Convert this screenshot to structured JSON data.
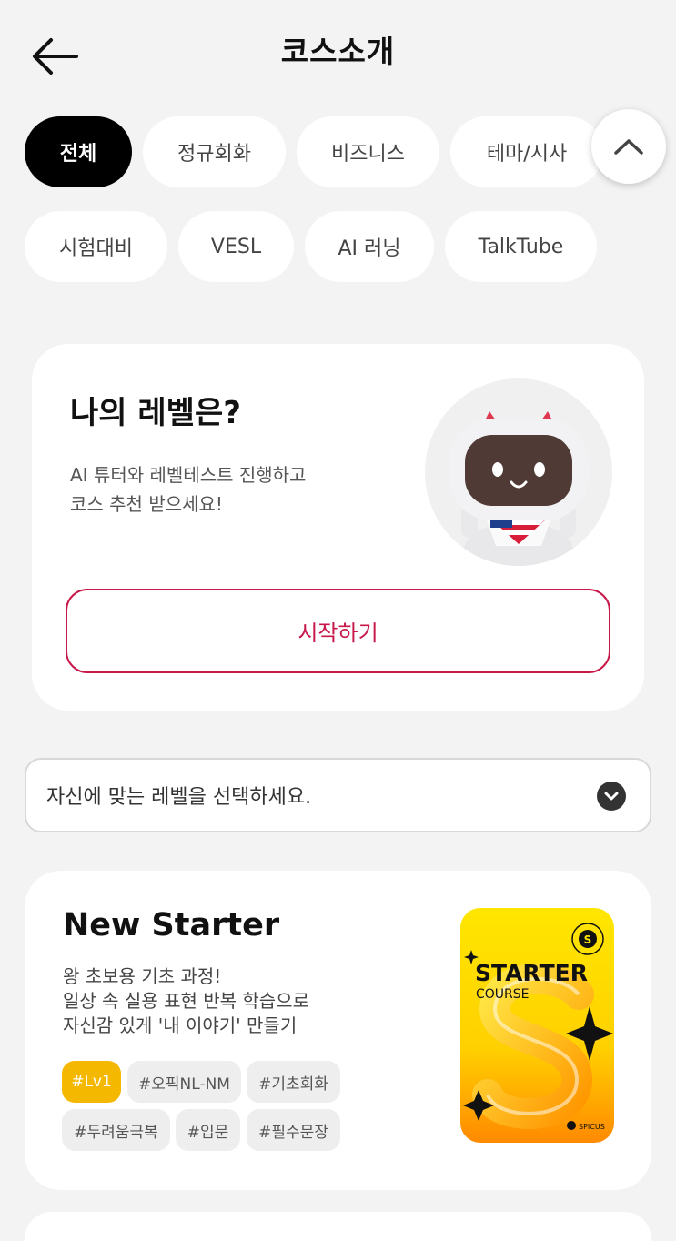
{
  "header": {
    "title": "코스소개"
  },
  "filters": {
    "chips": [
      {
        "label": "전체",
        "active": true
      },
      {
        "label": "정규회화",
        "active": false
      },
      {
        "label": "비즈니스",
        "active": false
      },
      {
        "label": "테마/시사",
        "active": false
      },
      {
        "label": "시험대비",
        "active": false
      },
      {
        "label": "VESL",
        "active": false
      },
      {
        "label": "AI 러닝",
        "active": false
      },
      {
        "label": "TalkTube",
        "active": false
      }
    ]
  },
  "level_card": {
    "title": "나의 레벨은?",
    "description_lines": [
      "AI 튜터와 레벨테스트 진행하고",
      "코스 추천 받으세요!"
    ],
    "start_button_label": "시작하기"
  },
  "level_select": {
    "placeholder": "자신에 맞는 레벨을 선택하세요."
  },
  "course": {
    "title": "New Starter",
    "description_lines": [
      "왕 초보용 기초 과정!",
      "일상 속 실용 표현 반복 학습으로",
      "자신감 있게 '내 이야기' 만들기"
    ],
    "tags": [
      "#Lv1",
      "#오픽NL-NM",
      "#기초회화",
      "#두려움극복",
      "#입문",
      "#필수문장"
    ],
    "image": {
      "title": "STARTER",
      "subtitle": "COURSE",
      "brand": "SPICUS",
      "badge": "S"
    }
  },
  "colors": {
    "accent": "#c8184a",
    "tag_primary": "#f5b800",
    "active_chip": "#000000"
  }
}
